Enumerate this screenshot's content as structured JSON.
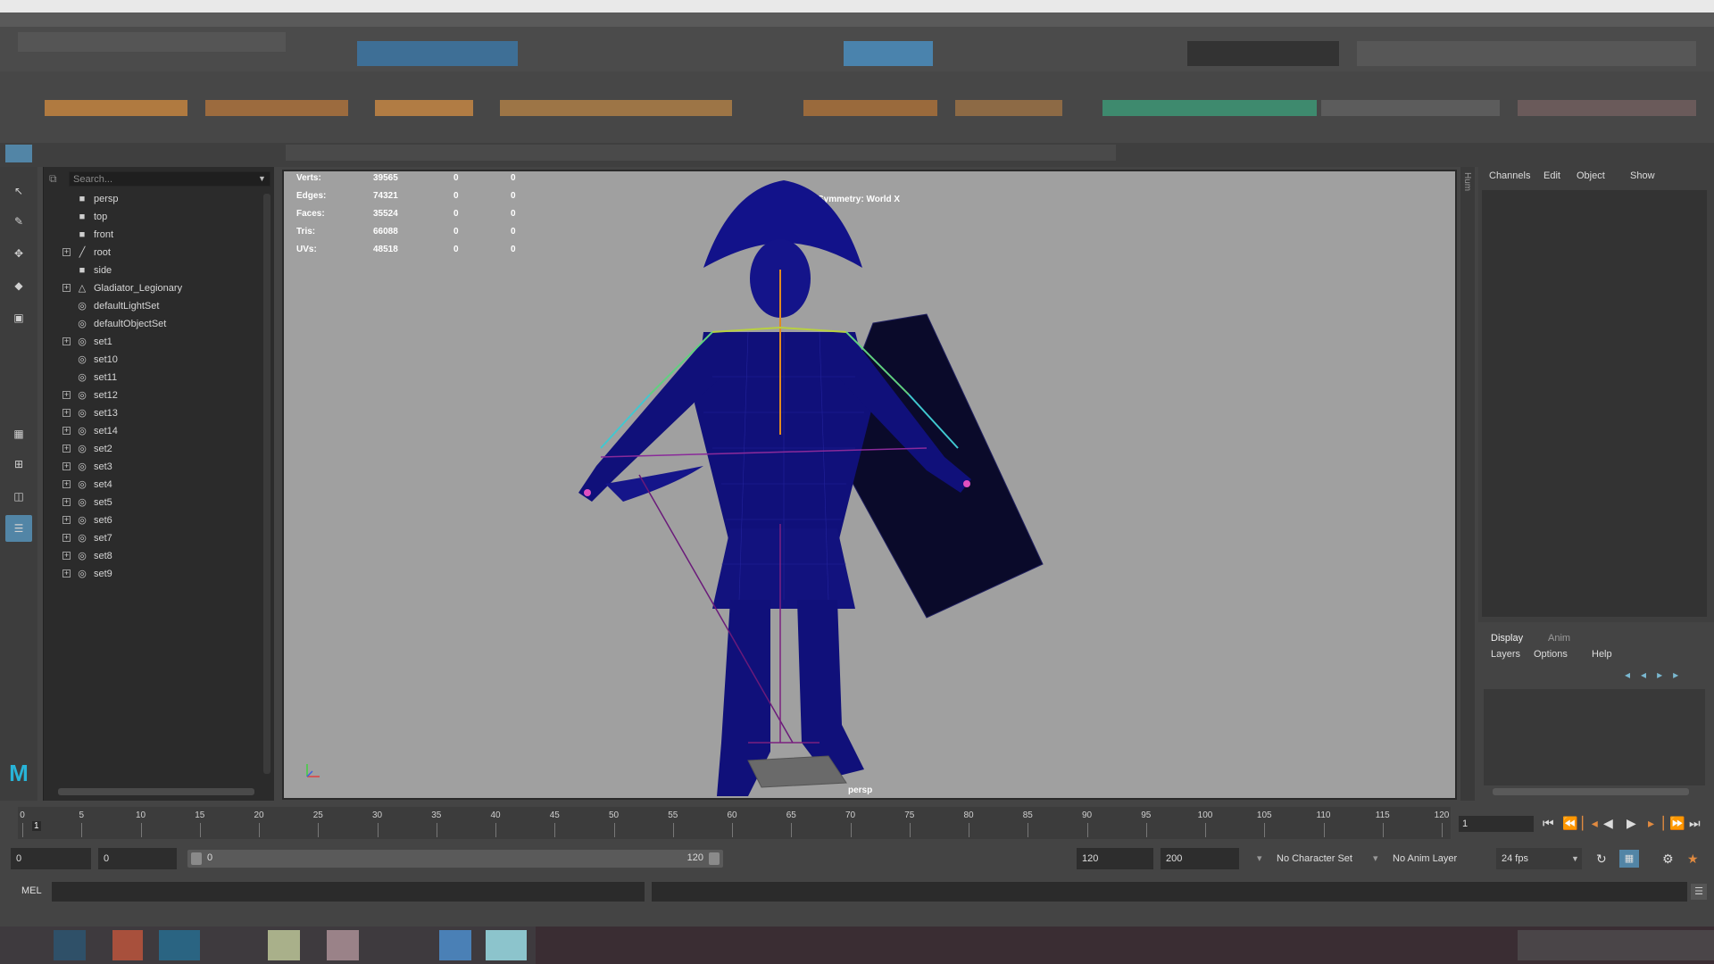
{
  "colors": {
    "viewport_bg": "#a0a0a0",
    "selection_blue": "#5285a6",
    "mesh_blue": "#10107a"
  },
  "outliner": {
    "search_placeholder": "Search...",
    "items": [
      {
        "label": "persp",
        "icon": "camera-icon",
        "expandable": false
      },
      {
        "label": "top",
        "icon": "camera-icon",
        "expandable": false
      },
      {
        "label": "front",
        "icon": "camera-icon",
        "expandable": false
      },
      {
        "label": "root",
        "icon": "joint-icon",
        "expandable": true
      },
      {
        "label": "side",
        "icon": "camera-icon",
        "expandable": false
      },
      {
        "label": "Gladiator_Legionary",
        "icon": "mesh-transform-icon",
        "expandable": true
      },
      {
        "label": "defaultLightSet",
        "icon": "set-icon",
        "expandable": false
      },
      {
        "label": "defaultObjectSet",
        "icon": "set-icon",
        "expandable": false
      },
      {
        "label": "set1",
        "icon": "set-icon",
        "expandable": true
      },
      {
        "label": "set10",
        "icon": "set-icon",
        "expandable": false
      },
      {
        "label": "set11",
        "icon": "set-icon",
        "expandable": false
      },
      {
        "label": "set12",
        "icon": "set-icon",
        "expandable": true
      },
      {
        "label": "set13",
        "icon": "set-icon",
        "expandable": true
      },
      {
        "label": "set14",
        "icon": "set-icon",
        "expandable": true
      },
      {
        "label": "set2",
        "icon": "set-icon",
        "expandable": true
      },
      {
        "label": "set3",
        "icon": "set-icon",
        "expandable": true
      },
      {
        "label": "set4",
        "icon": "set-icon",
        "expandable": true
      },
      {
        "label": "set5",
        "icon": "set-icon",
        "expandable": true
      },
      {
        "label": "set6",
        "icon": "set-icon",
        "expandable": true
      },
      {
        "label": "set7",
        "icon": "set-icon",
        "expandable": true
      },
      {
        "label": "set8",
        "icon": "set-icon",
        "expandable": true
      },
      {
        "label": "set9",
        "icon": "set-icon",
        "expandable": true
      }
    ]
  },
  "viewport": {
    "hud_stats": [
      {
        "label": "Verts:",
        "values": [
          "39565",
          "0",
          "0"
        ]
      },
      {
        "label": "Edges:",
        "values": [
          "74321",
          "0",
          "0"
        ]
      },
      {
        "label": "Faces:",
        "values": [
          "35524",
          "0",
          "0"
        ]
      },
      {
        "label": "Tris:",
        "values": [
          "66088",
          "0",
          "0"
        ]
      },
      {
        "label": "UVs:",
        "values": [
          "48518",
          "0",
          "0"
        ]
      }
    ],
    "symmetry": "Symmetry: World X",
    "camera_label": "persp"
  },
  "channel_box": {
    "menus": [
      "Channels",
      "Edit",
      "Object",
      "Show"
    ],
    "side_tab": "Hum"
  },
  "layer_editor": {
    "tabs": [
      "Display",
      "Anim"
    ],
    "menus": [
      "Layers",
      "Options",
      "Help"
    ]
  },
  "timeline": {
    "ticks": [
      "0",
      "5",
      "10",
      "15",
      "20",
      "25",
      "30",
      "35",
      "40",
      "45",
      "50",
      "55",
      "60",
      "65",
      "70",
      "75",
      "80",
      "85",
      "90",
      "95",
      "100",
      "105",
      "110",
      "115",
      "120"
    ],
    "current_frame_marker": "1",
    "current_frame": "1"
  },
  "range": {
    "anim_start": "0",
    "playback_start": "0",
    "slider_start": "0",
    "slider_end": "120",
    "playback_end": "120",
    "anim_end": "200",
    "character_set": "No Character Set",
    "anim_layer": "No Anim Layer",
    "fps": "24 fps"
  },
  "command_line": {
    "mode": "MEL"
  }
}
